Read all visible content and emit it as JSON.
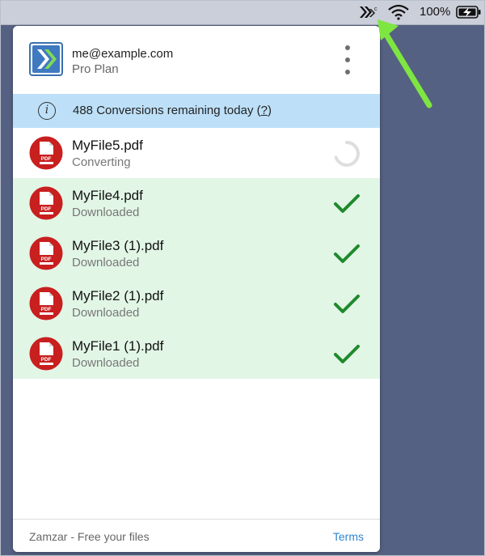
{
  "menubar": {
    "battery_percent": "100%",
    "icons": [
      "zamzar-icon",
      "wifi-icon",
      "battery-charging-icon"
    ]
  },
  "account": {
    "email": "me@example.com",
    "plan": "Pro Plan"
  },
  "info": {
    "text_prefix": "488 Conversions remaining today (",
    "help_label": "?",
    "text_suffix": ")"
  },
  "files": [
    {
      "name": "MyFile5.pdf",
      "status": "Converting",
      "state": "converting",
      "icon_label": "PDF"
    },
    {
      "name": "MyFile4.pdf",
      "status": "Downloaded",
      "state": "downloaded",
      "icon_label": "PDF"
    },
    {
      "name": "MyFile3 (1).pdf",
      "status": "Downloaded",
      "state": "downloaded",
      "icon_label": "PDF"
    },
    {
      "name": "MyFile2 (1).pdf",
      "status": "Downloaded",
      "state": "downloaded",
      "icon_label": "PDF"
    },
    {
      "name": "MyFile1 (1).pdf",
      "status": "Downloaded",
      "state": "downloaded",
      "icon_label": "PDF"
    }
  ],
  "footer": {
    "tagline": "Zamzar - Free your files",
    "terms_label": "Terms"
  },
  "colors": {
    "desktop": "#556182",
    "info_bar": "#bde0f8",
    "downloaded_row": "#e2f6e6",
    "check": "#1f8a2c",
    "link": "#2f86cf",
    "annotation_arrow": "#7ee640"
  }
}
